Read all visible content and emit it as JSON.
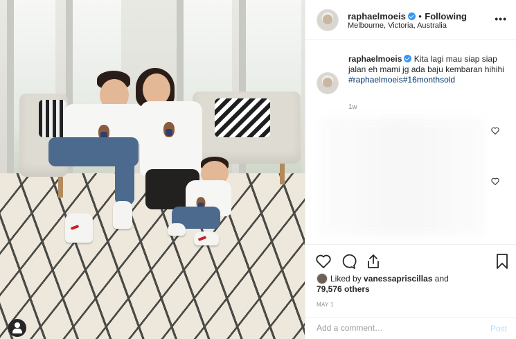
{
  "header": {
    "username": "raphaelmoeis",
    "separator": "•",
    "follow_label": "Following",
    "location": "Melbourne, Victoria, Australia",
    "more_label": "•••"
  },
  "caption": {
    "username": "raphaelmoeis",
    "text": "Kita lagi mau siap siap jalan eh mami jg ada baju kembaran hihihi",
    "hashtags": "#raphaelmoeis#16monthsold",
    "age": "1w"
  },
  "likes": {
    "prefix": "Liked by",
    "user": "vanessapriscillas",
    "suffix": "and",
    "count_text": "79,576 others"
  },
  "post_date": "MAY 1",
  "add_comment": {
    "placeholder": "Add a comment…",
    "post_label": "Post"
  },
  "icons": {
    "like": "heart-icon",
    "comment": "comment-icon",
    "share": "share-icon",
    "save": "bookmark-icon",
    "verified": "verified-badge-icon",
    "profile": "user-profile-icon"
  },
  "colors": {
    "verified_blue": "#3897f0",
    "hashtag": "#003569",
    "post_disabled": "#b2dffc",
    "muted": "#8e8e8e"
  }
}
